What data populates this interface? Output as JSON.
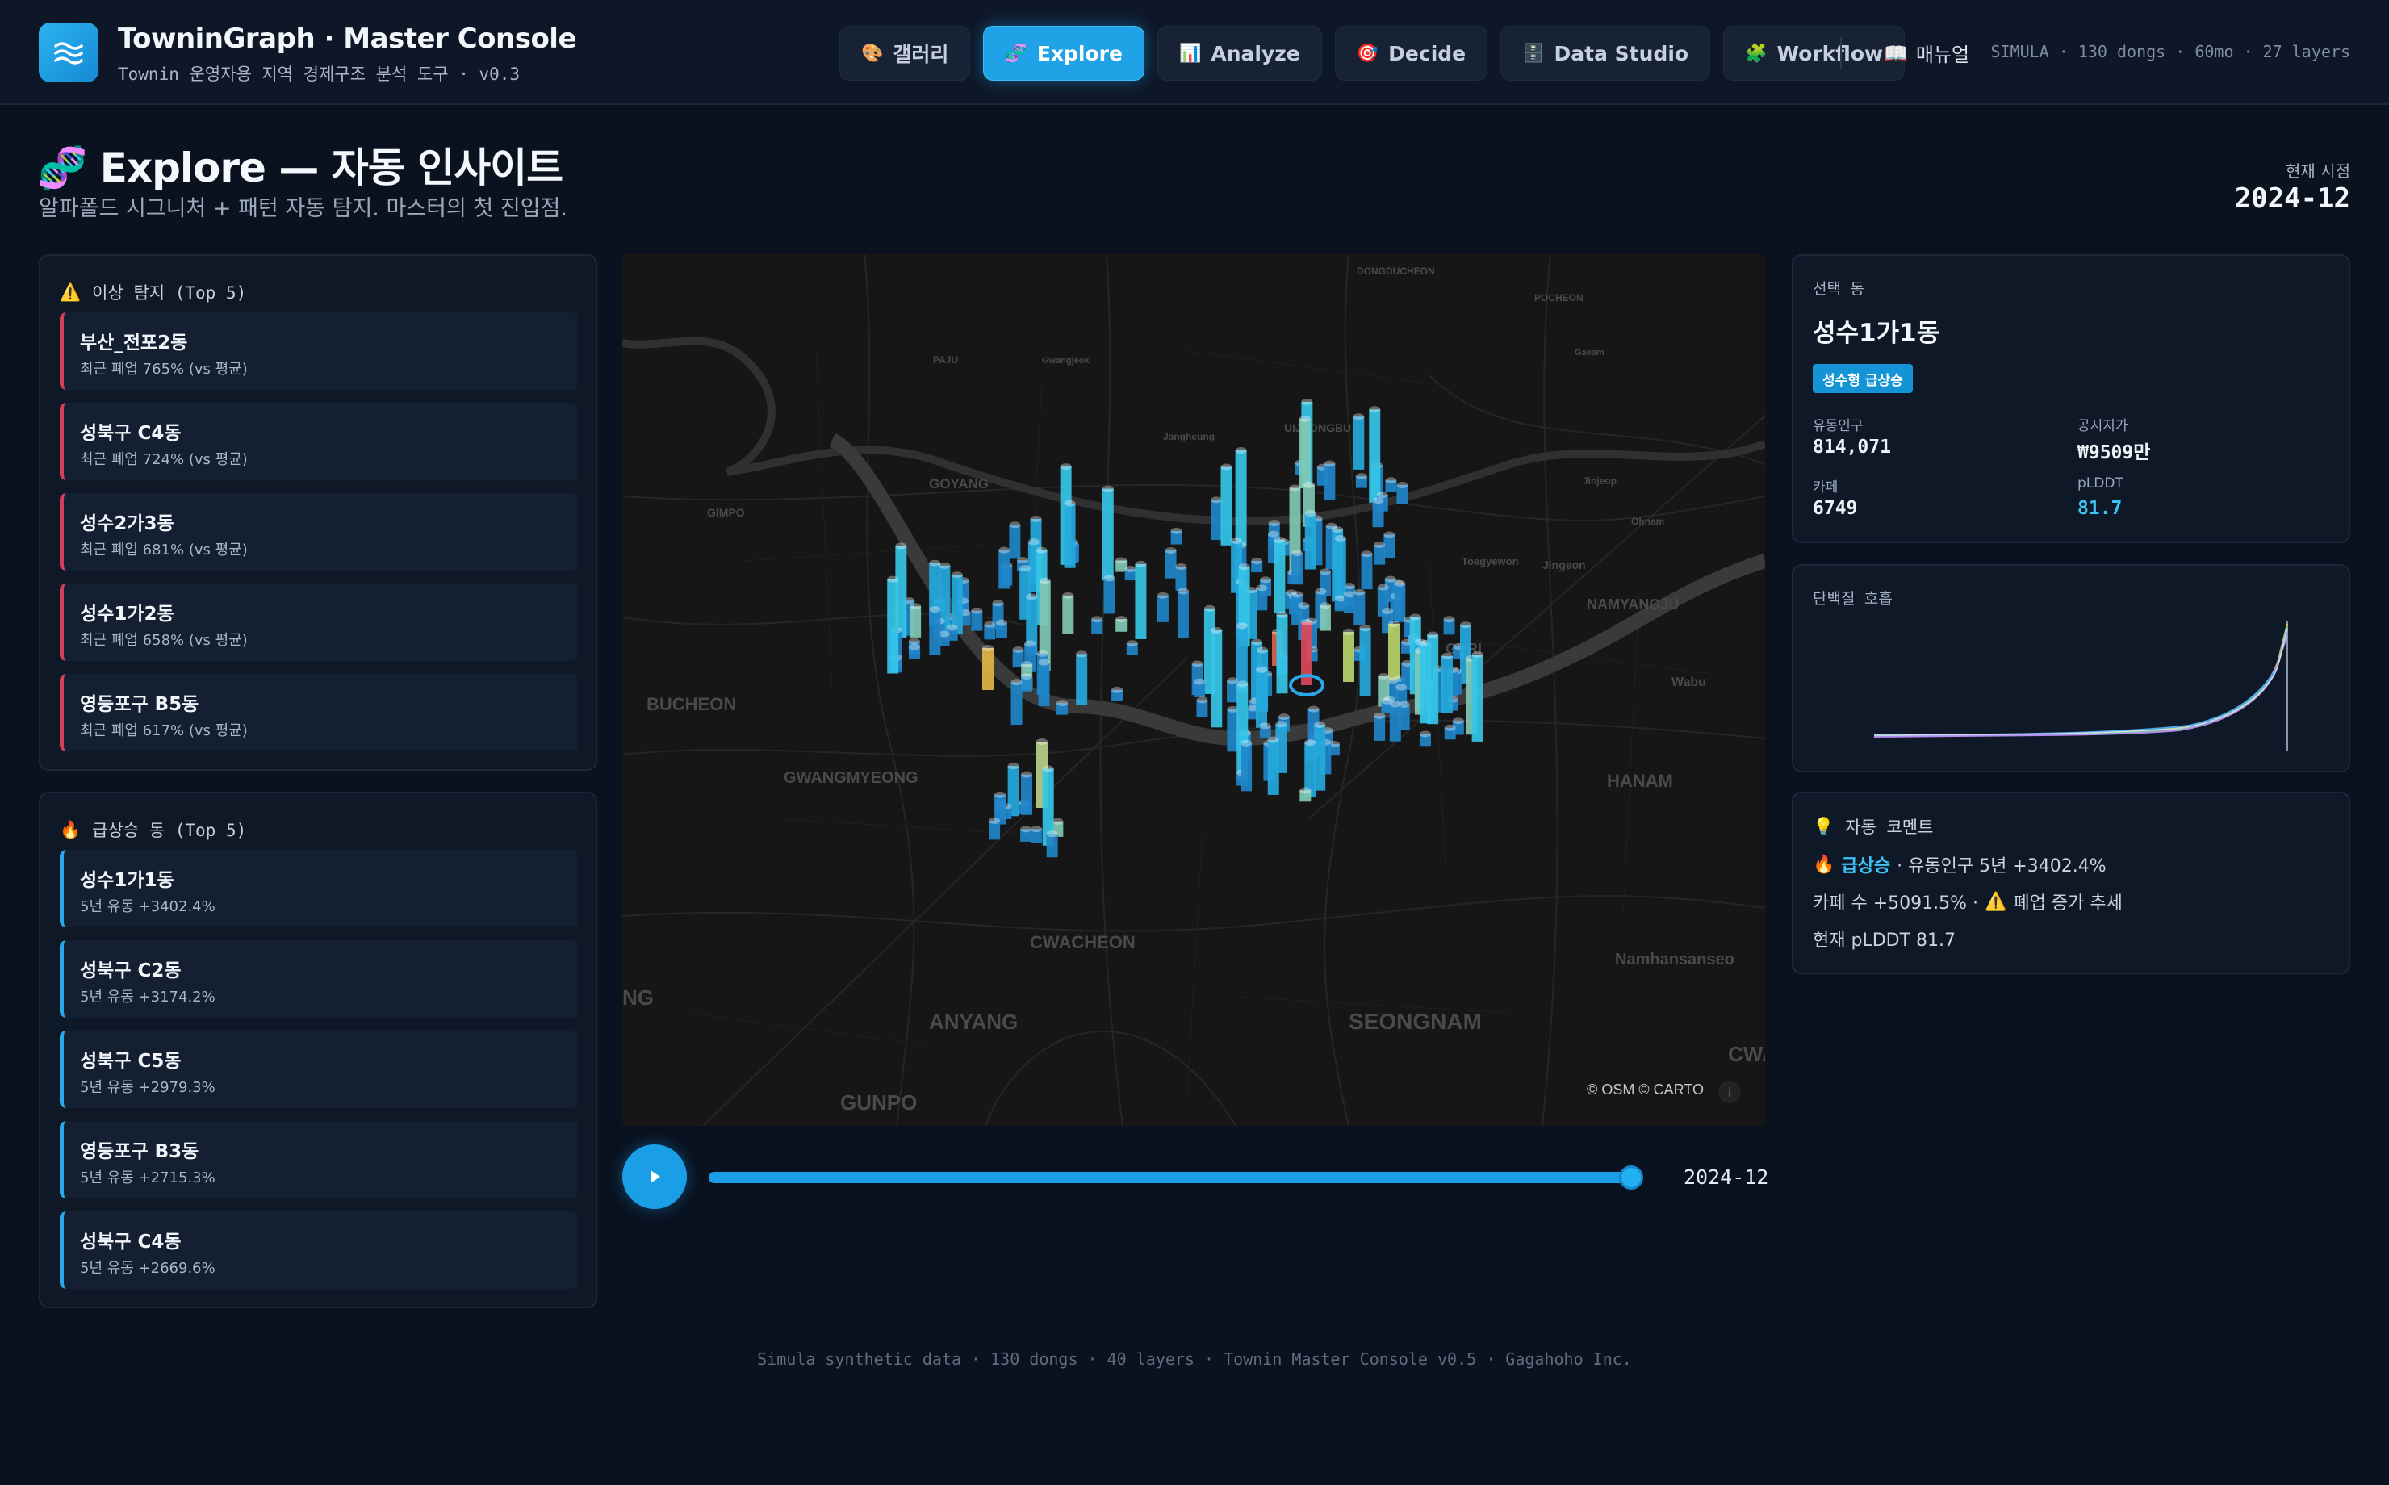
{
  "app": {
    "title": "TowninGraph · Master Console",
    "subtitle": "Townin 운영자용 지역 경제구조 분석 도구 · v0.3"
  },
  "nav": {
    "tabs": [
      {
        "icon": "palette-icon",
        "glyph": "🎨",
        "label": "갤러리",
        "active": false
      },
      {
        "icon": "dna-icon",
        "glyph": "🧬",
        "label": "Explore",
        "active": true
      },
      {
        "icon": "chart-icon",
        "glyph": "📊",
        "label": "Analyze",
        "active": false
      },
      {
        "icon": "target-icon",
        "glyph": "🎯",
        "label": "Decide",
        "active": false
      },
      {
        "icon": "database-icon",
        "glyph": "🗄️",
        "label": "Data Studio",
        "active": false
      },
      {
        "icon": "puzzle-icon",
        "glyph": "🧩",
        "label": "Workflow",
        "active": false
      }
    ],
    "manual_label": "매뉴얼",
    "simula_info": "SIMULA · 130 dongs · 60mo · 27 layers"
  },
  "page": {
    "title": "Explore — 자동 인사이트",
    "subtitle": "알파폴드 시그니처 + 패턴 자동 탐지. 마스터의 첫 진입점.",
    "current_time_label": "현재 시점",
    "current_time": "2024-12"
  },
  "anomalies": {
    "header": "이상 탐지 (Top 5)",
    "items": [
      {
        "name": "부산_전포2동",
        "detail": "최근 폐업 765% (vs 평균)"
      },
      {
        "name": "성북구 C4동",
        "detail": "최근 폐업 724% (vs 평균)"
      },
      {
        "name": "성수2가3동",
        "detail": "최근 폐업 681% (vs 평균)"
      },
      {
        "name": "성수1가2동",
        "detail": "최근 폐업 658% (vs 평균)"
      },
      {
        "name": "영등포구 B5동",
        "detail": "최근 폐업 617% (vs 평균)"
      }
    ]
  },
  "risers": {
    "header": "급상승 동 (Top 5)",
    "items": [
      {
        "name": "성수1가1동",
        "detail": "5년 유동 +3402.4%"
      },
      {
        "name": "성북구 C2동",
        "detail": "5년 유동 +3174.2%"
      },
      {
        "name": "성북구 C5동",
        "detail": "5년 유동 +2979.3%"
      },
      {
        "name": "영등포구 B3동",
        "detail": "5년 유동 +2715.3%"
      },
      {
        "name": "성북구 C4동",
        "detail": "5년 유동 +2669.6%"
      }
    ]
  },
  "map": {
    "labels": [
      "GOYANG",
      "BUCHEON",
      "GWANGMYEONG",
      "CWACHEON",
      "ANYANG",
      "GUNPO",
      "SEONGNAM",
      "HANAM",
      "GURI",
      "NAMYANGJU",
      "Namhansanseo",
      "UIJEONGBU",
      "Jinjeop",
      "Ohnam",
      "GIMPO",
      "DONGDUCHEON",
      "POCHEON",
      "Wabu",
      "Toegyewon",
      "Jingeon",
      "CWA",
      "NG",
      "PAJU",
      "Jangheung",
      "Gwangjeok",
      "Gaeam"
    ],
    "attribution": "© OSM © CARTO"
  },
  "timeline": {
    "value_label": "2024-12",
    "progress": 1.0
  },
  "selected": {
    "header": "선택 동",
    "name": "성수1가1동",
    "badge": "성수형 급상승",
    "stats": [
      {
        "label": "유동인구",
        "value": "814,071",
        "highlight": false
      },
      {
        "label": "공시지가",
        "value": "₩9509만",
        "highlight": false
      },
      {
        "label": "카페",
        "value": "6749",
        "highlight": false
      },
      {
        "label": "pLDDT",
        "value": "81.7",
        "highlight": true
      }
    ]
  },
  "protein": {
    "header": "단백질 호흡"
  },
  "comment": {
    "header": "자동 코멘트",
    "line1_prefix": "급상승",
    "line1_rest": "· 유동인구 5년 +3402.4%",
    "line2_a": "카페 수 +5091.5% ·",
    "line2_b": "폐업 증가 추세",
    "line3": "현재 pLDDT 81.7"
  },
  "colors": {
    "accent": "#1fa3e6",
    "anomaly": "#d2405a",
    "highlight": "#3ec1f5"
  },
  "footer": "Simula synthetic data · 130 dongs · 40 layers · Townin Master Console v0.5 · Gagahoho Inc."
}
